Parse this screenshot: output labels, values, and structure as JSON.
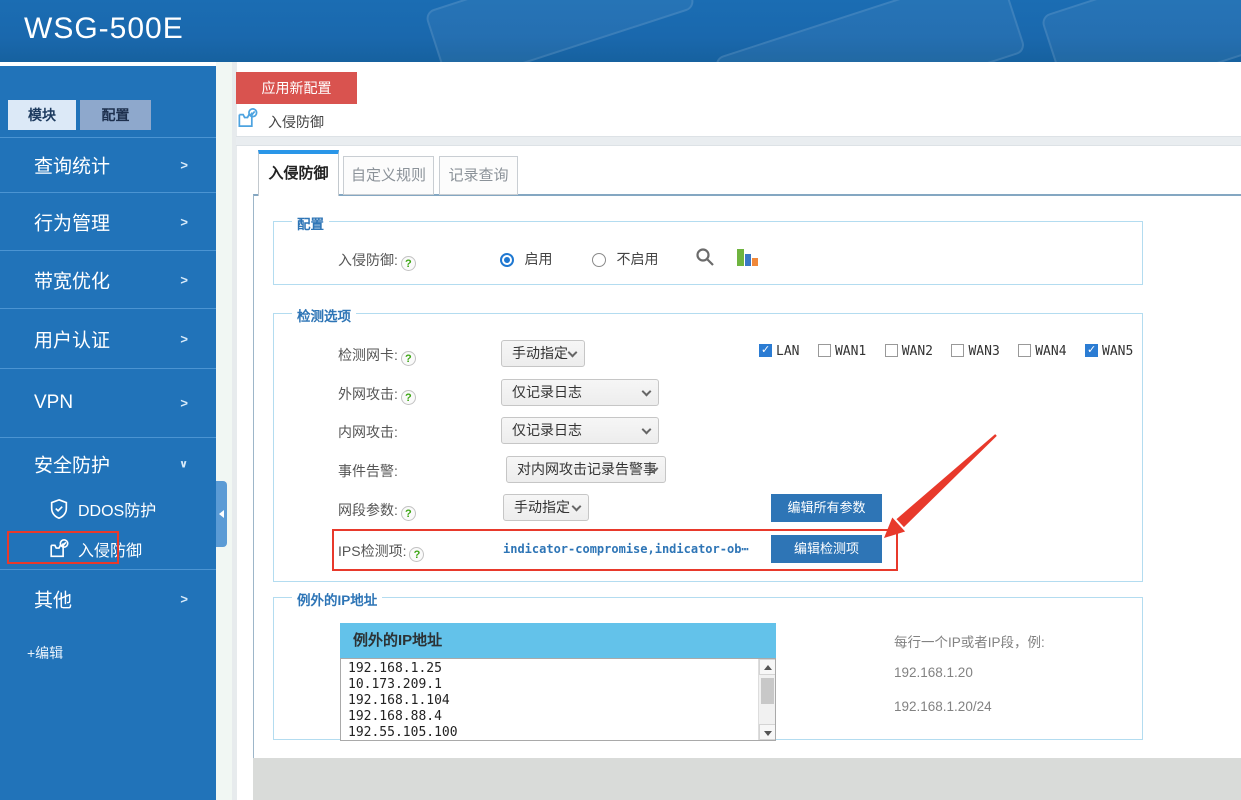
{
  "app": {
    "title": "WSG-500E"
  },
  "sidebar": {
    "tabs": [
      {
        "label": "模块"
      },
      {
        "label": "配置"
      }
    ],
    "menu": [
      {
        "label": "查询统计",
        "chevron": ">"
      },
      {
        "label": "行为管理",
        "chevron": ">"
      },
      {
        "label": "带宽优化",
        "chevron": ">"
      },
      {
        "label": "用户认证",
        "chevron": ">"
      },
      {
        "label": "VPN",
        "chevron": ">"
      },
      {
        "label": "安全防护",
        "chevron": "∨"
      }
    ],
    "submenu": [
      {
        "label": "DDOS防护"
      },
      {
        "label": "入侵防御",
        "highlighted": true
      }
    ],
    "other": {
      "label": "其他",
      "chevron": ">"
    },
    "edit": "+编辑"
  },
  "toolbar": {
    "apply": "应用新配置",
    "breadcrumb": "入侵防御"
  },
  "tabs": [
    {
      "label": "入侵防御"
    },
    {
      "label": "自定义规则"
    },
    {
      "label": "记录查询"
    }
  ],
  "config": {
    "legend": "配置",
    "label": "入侵防御:",
    "options": [
      {
        "label": "启用",
        "checked": true
      },
      {
        "label": "不启用",
        "checked": false
      }
    ]
  },
  "detection": {
    "legend": "检测选项",
    "nic": {
      "label": "检测网卡:",
      "value": "手动指定"
    },
    "interfaces": [
      {
        "label": "LAN",
        "checked": true
      },
      {
        "label": "WAN1",
        "checked": false
      },
      {
        "label": "WAN2",
        "checked": false
      },
      {
        "label": "WAN3",
        "checked": false
      },
      {
        "label": "WAN4",
        "checked": false
      },
      {
        "label": "WAN5",
        "checked": true
      }
    ],
    "wan_attack": {
      "label": "外网攻击:",
      "value": "仅记录日志"
    },
    "lan_attack": {
      "label": "内网攻击:",
      "value": "仅记录日志"
    },
    "alert": {
      "label": "事件告警:",
      "value": "对内网攻击记录告警事"
    },
    "segment": {
      "label": "网段参数:",
      "value": "手动指定",
      "button": "编辑所有参数"
    },
    "ips": {
      "label": "IPS检测项:",
      "value": "indicator-compromise,indicator-ob⋯",
      "button": "编辑检测项"
    }
  },
  "exceptions": {
    "legend": "例外的IP地址",
    "header": "例外的IP地址",
    "ips": [
      "192.168.1.25",
      "10.173.209.1",
      "192.168.1.104",
      "192.168.88.4",
      "192.55.105.100"
    ],
    "hint": {
      "title": "每行一个IP或者IP段，例:",
      "examples": [
        "192.168.1.20",
        "192.168.1.20/24"
      ]
    }
  },
  "colors": {
    "header_blue": "#1a6cb0",
    "sidebar_blue": "#2173b9",
    "accent_red": "#d9534f",
    "button_blue": "#2e75b6",
    "tab_blue": "#2a96e8",
    "checkbox_blue": "#2b7cd3",
    "annotation_red": "#e8392b",
    "list_header_blue": "#63c2ea"
  }
}
